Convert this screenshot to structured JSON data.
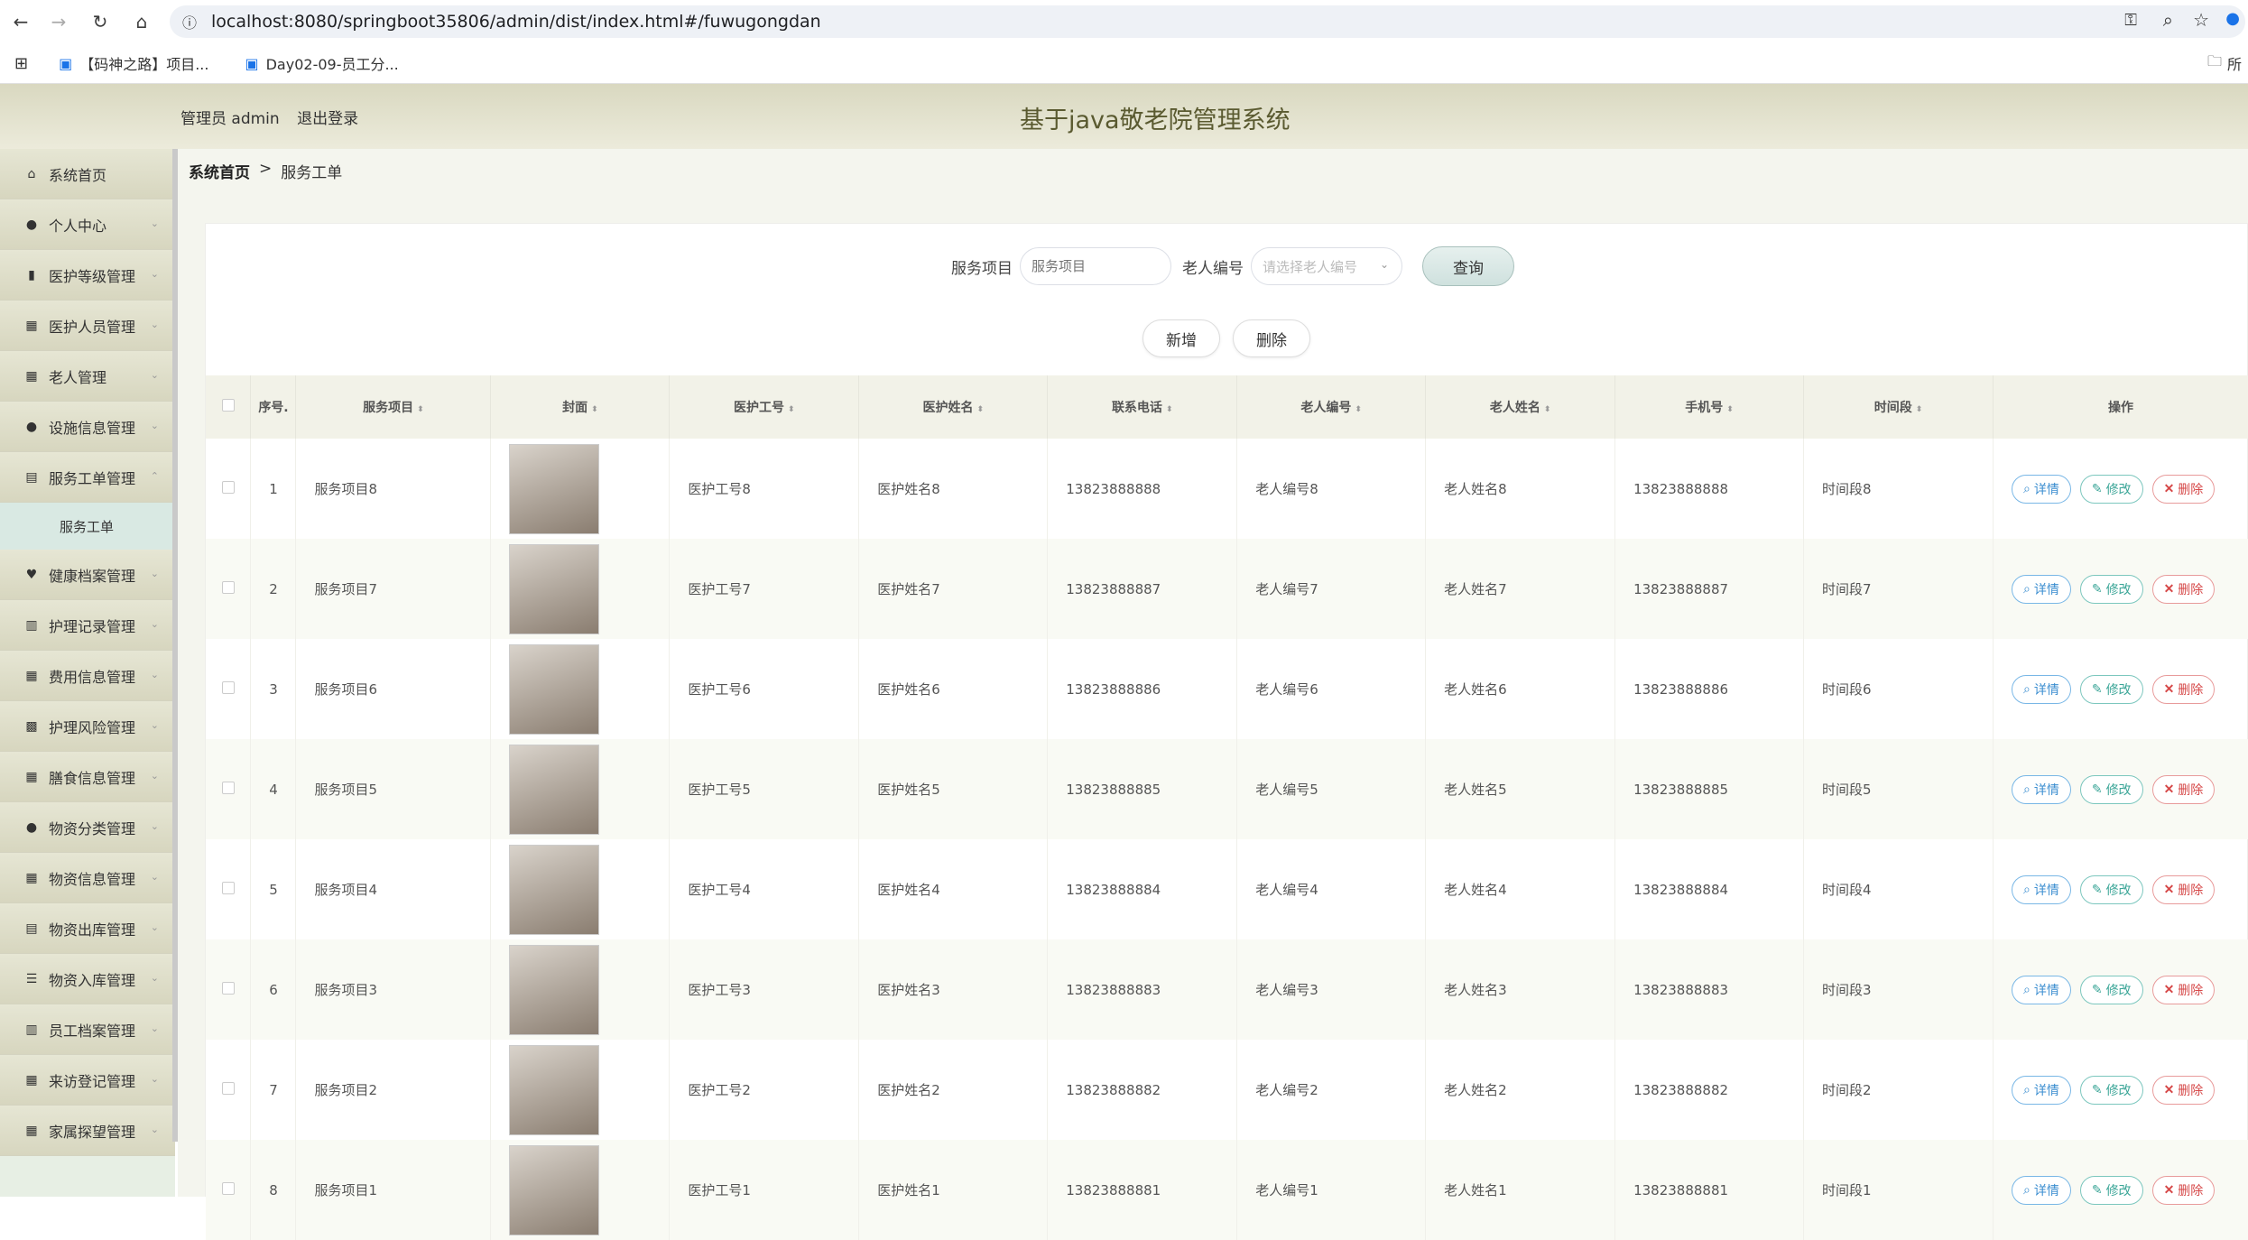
{
  "browser": {
    "url": "localhost:8080/springboot35806/admin/dist/index.html#/fuwugongdan",
    "bookmarks": [
      "【码神之路】项目...",
      "Day02-09-员工分..."
    ],
    "bookmark_folder": "所"
  },
  "header": {
    "user_label": "管理员 admin",
    "logout_label": "退出登录",
    "title": "基于java敬老院管理系统"
  },
  "sidebar": {
    "items": [
      {
        "label": "系统首页",
        "icon": "home-icon"
      },
      {
        "label": "个人中心",
        "icon": "user-icon"
      },
      {
        "label": "医护等级管理",
        "icon": "bars-icon"
      },
      {
        "label": "医护人员管理",
        "icon": "grid-icon"
      },
      {
        "label": "老人管理",
        "icon": "grid-icon"
      },
      {
        "label": "设施信息管理",
        "icon": "user-icon"
      },
      {
        "label": "服务工单管理",
        "icon": "doc-icon"
      },
      {
        "label": "健康档案管理",
        "icon": "cup-icon"
      },
      {
        "label": "护理记录管理",
        "icon": "chart-icon"
      },
      {
        "label": "费用信息管理",
        "icon": "grid-icon"
      },
      {
        "label": "护理风险管理",
        "icon": "apps-icon"
      },
      {
        "label": "膳食信息管理",
        "icon": "grid-icon"
      },
      {
        "label": "物资分类管理",
        "icon": "user-icon"
      },
      {
        "label": "物资信息管理",
        "icon": "grid-icon"
      },
      {
        "label": "物资出库管理",
        "icon": "doc-icon"
      },
      {
        "label": "物资入库管理",
        "icon": "list-icon"
      },
      {
        "label": "员工档案管理",
        "icon": "chart-icon"
      },
      {
        "label": "来访登记管理",
        "icon": "grid-icon"
      },
      {
        "label": "家属探望管理",
        "icon": "grid-icon"
      }
    ],
    "sub_item": "服务工单"
  },
  "breadcrumb": {
    "home": "系统首页",
    "sep": ">",
    "current": "服务工单"
  },
  "search": {
    "service_label": "服务项目",
    "service_placeholder": "服务项目",
    "elder_label": "老人编号",
    "elder_placeholder": "请选择老人编号",
    "query_label": "查询"
  },
  "actions": {
    "add_label": "新增",
    "delete_label": "删除"
  },
  "table": {
    "headers": [
      "序号.",
      "服务项目",
      "封面",
      "医护工号",
      "医护姓名",
      "联系电话",
      "老人编号",
      "老人姓名",
      "手机号",
      "时间段",
      "操作"
    ],
    "op_labels": {
      "detail": "详情",
      "edit": "修改",
      "delete": "删除"
    },
    "rows": [
      {
        "idx": "1",
        "service": "服务项目8",
        "staff_no": "医护工号8",
        "staff_name": "医护姓名8",
        "phone": "13823888888",
        "elder_no": "老人编号8",
        "elder_name": "老人姓名8",
        "mobile": "13823888888",
        "period": "时间段8"
      },
      {
        "idx": "2",
        "service": "服务项目7",
        "staff_no": "医护工号7",
        "staff_name": "医护姓名7",
        "phone": "13823888887",
        "elder_no": "老人编号7",
        "elder_name": "老人姓名7",
        "mobile": "13823888887",
        "period": "时间段7"
      },
      {
        "idx": "3",
        "service": "服务项目6",
        "staff_no": "医护工号6",
        "staff_name": "医护姓名6",
        "phone": "13823888886",
        "elder_no": "老人编号6",
        "elder_name": "老人姓名6",
        "mobile": "13823888886",
        "period": "时间段6"
      },
      {
        "idx": "4",
        "service": "服务项目5",
        "staff_no": "医护工号5",
        "staff_name": "医护姓名5",
        "phone": "13823888885",
        "elder_no": "老人编号5",
        "elder_name": "老人姓名5",
        "mobile": "13823888885",
        "period": "时间段5"
      },
      {
        "idx": "5",
        "service": "服务项目4",
        "staff_no": "医护工号4",
        "staff_name": "医护姓名4",
        "phone": "13823888884",
        "elder_no": "老人编号4",
        "elder_name": "老人姓名4",
        "mobile": "13823888884",
        "period": "时间段4"
      },
      {
        "idx": "6",
        "service": "服务项目3",
        "staff_no": "医护工号3",
        "staff_name": "医护姓名3",
        "phone": "13823888883",
        "elder_no": "老人编号3",
        "elder_name": "老人姓名3",
        "mobile": "13823888883",
        "period": "时间段3"
      },
      {
        "idx": "7",
        "service": "服务项目2",
        "staff_no": "医护工号2",
        "staff_name": "医护姓名2",
        "phone": "13823888882",
        "elder_no": "老人编号2",
        "elder_name": "老人姓名2",
        "mobile": "13823888882",
        "period": "时间段2"
      },
      {
        "idx": "8",
        "service": "服务项目1",
        "staff_no": "医护工号1",
        "staff_name": "医护姓名1",
        "phone": "13823888881",
        "elder_no": "老人编号1",
        "elder_name": "老人姓名1",
        "mobile": "13823888881",
        "period": "时间段1"
      }
    ]
  },
  "colors": {
    "accent": "#3aa597",
    "danger": "#d64848",
    "info": "#3b8ed0",
    "header_bg": "#d9d8c0",
    "sidebar_active": "#d9e9e3"
  }
}
